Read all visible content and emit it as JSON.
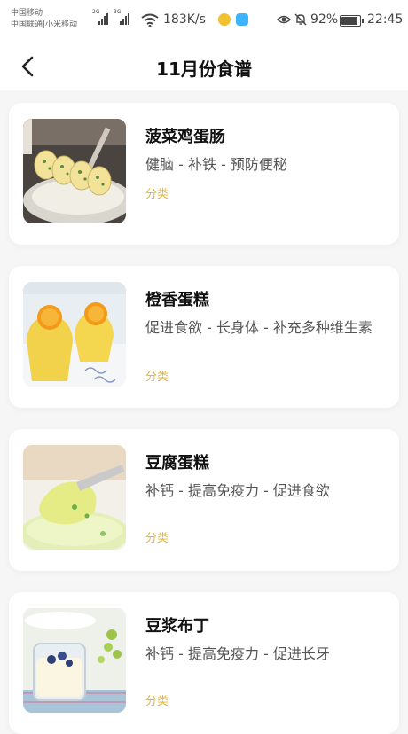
{
  "status_bar": {
    "carrier_1": "中国移动",
    "carrier_2": "中国联通|小米移动",
    "sig1_tag": "2G",
    "sig2_tag": "3G",
    "speed": "183K/s",
    "battery": "92%",
    "time": "22:45",
    "app_icon_colors": [
      "#f2c12e",
      "#3cb4ff"
    ]
  },
  "header": {
    "title": "11月份食谱",
    "back_icon": "chevron-left-icon"
  },
  "recipes": [
    {
      "name": "菠菜鸡蛋肠",
      "desc": "健脑 - 补铁 - 预防便秘",
      "category": "分类"
    },
    {
      "name": "橙香蛋糕",
      "desc": "促进食欲 - 长身体 - 补充多种维生素",
      "category": "分类"
    },
    {
      "name": "豆腐蛋糕",
      "desc": "补钙 - 提高免疫力 - 促进食欲",
      "category": "分类"
    },
    {
      "name": "豆浆布丁",
      "desc": "补钙 - 提高免疫力 - 促进长牙",
      "category": "分类"
    }
  ],
  "colors": {
    "category_accent": "#e0b740",
    "background": "#f6f6f6"
  }
}
